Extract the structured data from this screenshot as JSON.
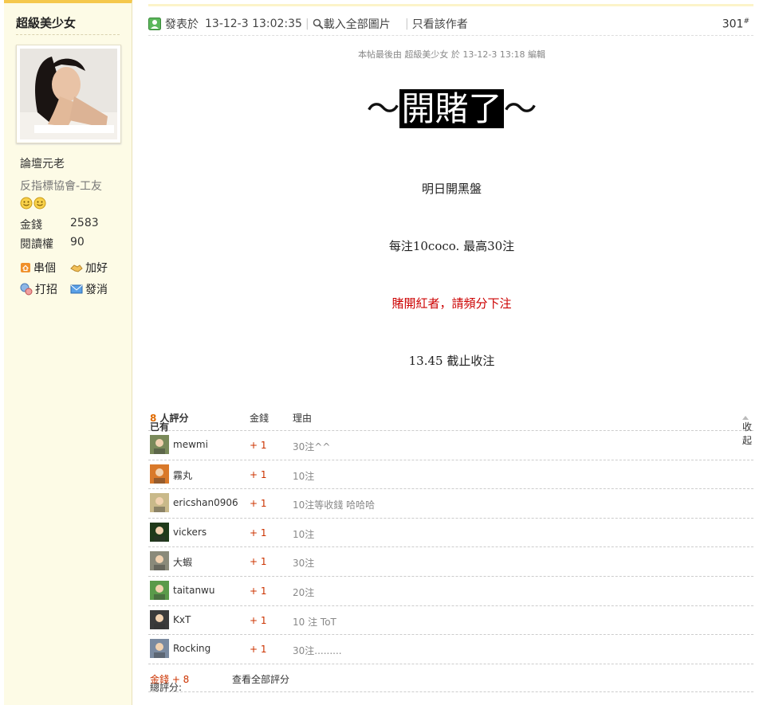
{
  "sidebar": {
    "username": "超級美少女",
    "rank": "論壇元老",
    "group": "反指標協會-工友",
    "stats": [
      {
        "label": "金錢",
        "value": "2583"
      },
      {
        "label": "閱讀權",
        "value": "90"
      }
    ],
    "actions": {
      "profile": "串個",
      "add_friend": "加好",
      "poke": "打招",
      "message": "發消"
    }
  },
  "post": {
    "posted_prefix": "發表於",
    "posted_time": "13-12-3 13:02:35",
    "load_images": "載入全部圖片",
    "author_only": "只看該作者",
    "floor": "301",
    "floor_mark": "#",
    "edited_note": "本帖最後由 超級美少女 於 13-12-3 13:18 編輯",
    "title_left": "～",
    "title_highlight": "開賭了",
    "title_right": "～",
    "lines": [
      "明日開黑盤",
      "每注10coco. 最高30注",
      "賭開紅者，請頻分下注",
      "13.45 截止收注"
    ]
  },
  "ratings": {
    "header_prefix": "已有",
    "count": "8",
    "header_suffix": "人評分",
    "col_money": "金錢",
    "col_reason": "理由",
    "collapse": "收起",
    "rows": [
      {
        "name": "mewmi",
        "points": "+ 1",
        "reason": "30注^^",
        "color": "#7a8a5a"
      },
      {
        "name": "霧丸",
        "points": "+ 1",
        "reason": "10注",
        "color": "#d9792a"
      },
      {
        "name": "ericshan0906",
        "points": "+ 1",
        "reason": "10注等收錢 哈哈哈",
        "color": "#c9b98a"
      },
      {
        "name": "vickers",
        "points": "+ 1",
        "reason": "10注",
        "color": "#1f3a1a"
      },
      {
        "name": "大蝦",
        "points": "+ 1",
        "reason": "30注",
        "color": "#8a8a7a"
      },
      {
        "name": "taitanwu",
        "points": "+ 1",
        "reason": "20注",
        "color": "#5a9a4a"
      },
      {
        "name": "KxT",
        "points": "+ 1",
        "reason": "10 注  ToT",
        "color": "#3a3a3a"
      },
      {
        "name": "Rocking",
        "points": "+ 1",
        "reason": "30注.........",
        "color": "#7a8aa0"
      }
    ],
    "total_label": "總評分:",
    "total_value": "金錢 + 8",
    "view_all": "查看全部評分"
  }
}
